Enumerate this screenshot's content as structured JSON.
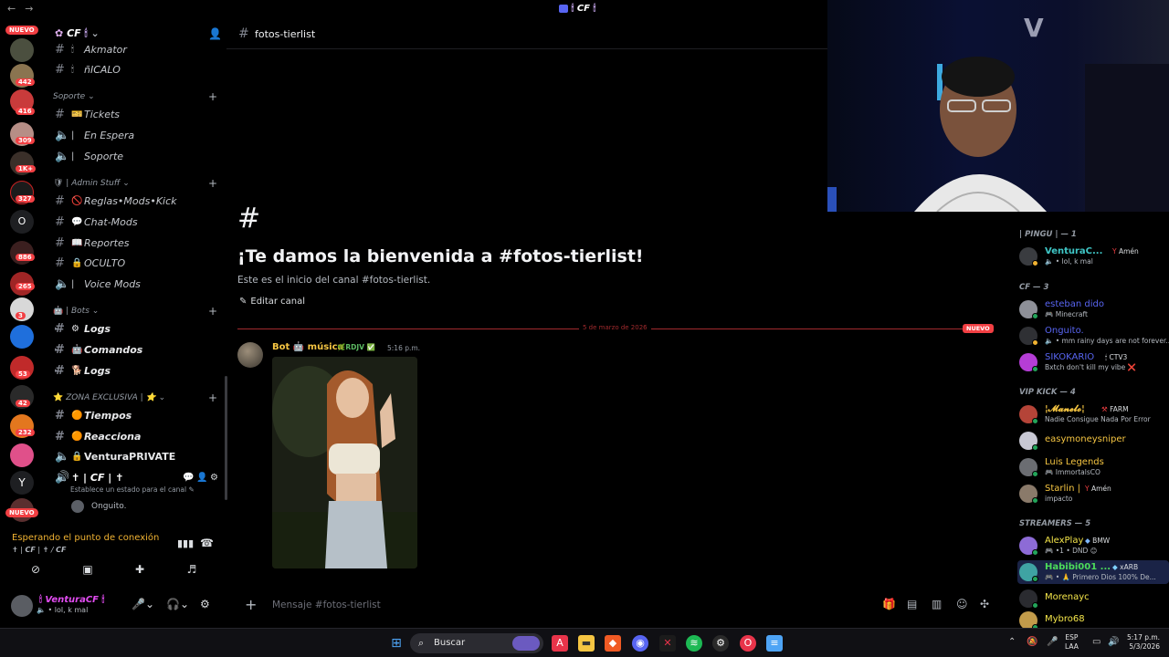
{
  "topbar": {
    "title": "𝘾𝙁",
    "back": "←",
    "forward": "→"
  },
  "rail": {
    "top_pill": "NUEVO",
    "bottom_pill": "NUEVO",
    "badges": [
      "442",
      "416",
      "309",
      "1K+",
      "327",
      "886",
      "265",
      "3",
      "53",
      "42",
      "232"
    ],
    "letter_server": "O"
  },
  "sidebar": {
    "server_name": "𝘾𝙁",
    "top_items": [
      {
        "label": "Akmator"
      },
      {
        "label": "ñICALO"
      }
    ],
    "categories": [
      {
        "name": "Soporte",
        "channels": [
          {
            "label": "Tickets",
            "type": "text",
            "icon": "🎫"
          },
          {
            "label": "En Espera",
            "type": "voice"
          },
          {
            "label": "Soporte",
            "type": "voice"
          }
        ]
      },
      {
        "name": "Admin Stuff",
        "channels": [
          {
            "label": "Reglas•Mods•Kick",
            "type": "text",
            "icon": "🚫"
          },
          {
            "label": "Chat-Mods",
            "type": "text",
            "icon": "💬"
          },
          {
            "label": "Reportes",
            "type": "text",
            "icon": "📖"
          },
          {
            "label": "OCULTO",
            "type": "text",
            "icon": "🔒"
          },
          {
            "label": "Voice Mods",
            "type": "voice"
          }
        ]
      },
      {
        "name": "Bots",
        "channels": [
          {
            "label": "Logs",
            "type": "text",
            "icon": "⚙"
          },
          {
            "label": "Comandos",
            "type": "text",
            "icon": "🤖"
          },
          {
            "label": "Logs",
            "type": "text",
            "icon": "🐕"
          }
        ]
      },
      {
        "name": "ZONA EXCLUSIVA | ⭐",
        "channels": [
          {
            "label": "Tiempos",
            "type": "text",
            "icon": "🟠"
          },
          {
            "label": "Reacciona",
            "type": "text",
            "icon": "🟠"
          },
          {
            "label": "VenturaPRIVATE",
            "type": "voice",
            "icon": "🔒"
          }
        ]
      }
    ],
    "voice_channel": {
      "label": "✝ | 𝘾𝙁 | ✝",
      "status_hint": "Establece un estado para el canal",
      "member": "Onguito."
    }
  },
  "voice_panel": {
    "status": "Esperando el punto de conexión",
    "subtitle": "✝ | 𝘾𝙁 | ✝ / 𝘾𝙁"
  },
  "user_panel": {
    "name": "VenturaCF",
    "status": "lol, k mal"
  },
  "channel": {
    "name": "fotos-tierlist",
    "welcome_title": "¡Te damos la bienvenida a #fotos-tierlist!",
    "welcome_sub": "Este es el inicio del canal #fotos-tierlist.",
    "edit_label": "Editar canal",
    "divider_date": "5 de marzo de 2026",
    "divider_new": "NUEVO"
  },
  "message": {
    "author": "Bot 🤖 música",
    "tag": "RDJV",
    "time": "5:16 p.m."
  },
  "composer": {
    "placeholder": "Mensaje #fotos-tierlist"
  },
  "members": {
    "groups": [
      {
        "title": "| PINGU | — 1",
        "members": [
          {
            "name": "VenturaC...",
            "tag": "Amén",
            "status": "lol, k mal",
            "color": "#3fc6c6"
          }
        ]
      },
      {
        "title": "CF — 3",
        "members": [
          {
            "name": "esteban dido",
            "tag": "",
            "status": "Minecraft",
            "color": "#5865f2"
          },
          {
            "name": "Onguito.",
            "tag": "",
            "status": "mm rainy days are not forever...",
            "color": "#5865f2"
          },
          {
            "name": "SIKOKARIO",
            "tag": "CTV3",
            "status": "Bxtch don't kill my vibe ❌",
            "color": "#5865f2"
          }
        ]
      },
      {
        "title": "VIP KICK — 4",
        "members": [
          {
            "name": "¦𝓜𝓪𝓷𝓮𝓵𝓸¦",
            "tag": "FARM",
            "status": "Nadie Consigue Nada Por Error",
            "color": "#f5c542"
          },
          {
            "name": "easymoneysniper",
            "tag": "",
            "status": "",
            "color": "#f5c542"
          },
          {
            "name": "Luis Legends",
            "tag": "",
            "status": "ImmortalsCO",
            "color": "#f5c542"
          },
          {
            "name": "Starlin |",
            "tag": "Amén",
            "status": "impacto",
            "color": "#f5c542"
          }
        ]
      },
      {
        "title": "STREAMERS — 5",
        "members": [
          {
            "name": "AlexPlay",
            "tag": "BMW",
            "status": "•1 • DND 😊",
            "color": "#f5e64a"
          },
          {
            "name": "Habibi001 ...",
            "tag": "xARB",
            "status": "🙏 Primero Dios 100% De...",
            "color": "#4cdc5a"
          },
          {
            "name": "Morenayc",
            "tag": "",
            "status": "",
            "color": "#f5e64a"
          },
          {
            "name": "Mybro68",
            "tag": "",
            "status": "",
            "color": "#f5e64a"
          }
        ]
      }
    ]
  },
  "taskbar": {
    "search_label": "Buscar",
    "lang": "ESP",
    "lang2": "LAA",
    "time": "5:17 p.m.",
    "date": "5/3/2026"
  }
}
